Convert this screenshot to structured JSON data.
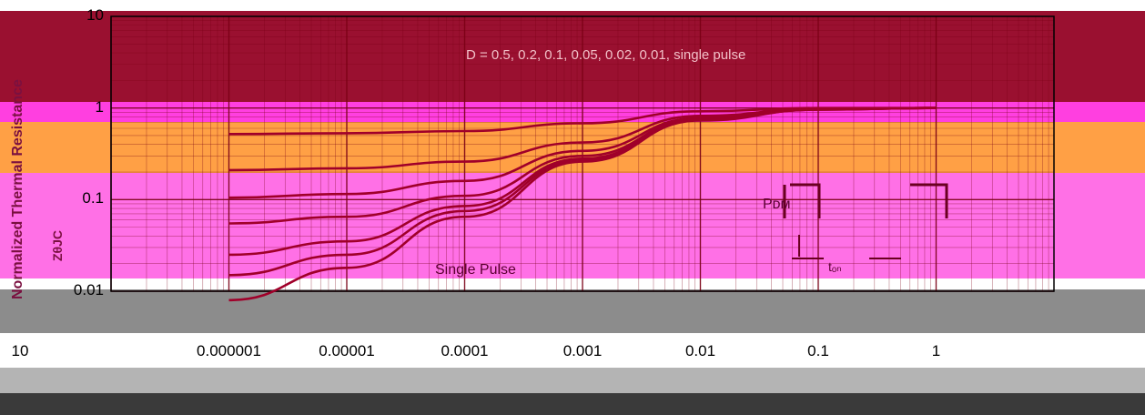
{
  "chart_data": {
    "type": "line",
    "xscale": "log",
    "yscale": "log",
    "xlim": [
      1e-07,
      10
    ],
    "ylim": [
      0.01,
      10
    ],
    "x_tick_labels": [
      "10",
      "0.000001",
      "0.00001",
      "0.0001",
      "0.001",
      "0.01",
      "0.1",
      "1"
    ],
    "y_tick_labels": [
      "10",
      "1",
      "0.1",
      "0.01"
    ],
    "ylabel": "Normalized Thermal Resistance",
    "ylabel_symbol": "ZθJC",
    "annotations": {
      "single_pulse": "Single Pulse",
      "pdm": "Pᴅᴍ",
      "t_on": "tₒₙ",
      "duty_legend": "D = 0.5, 0.2, 0.1, 0.05, 0.02, 0.01, single pulse"
    },
    "series": [
      {
        "name": "0.5",
        "x": [
          1e-06,
          1e-05,
          0.0001,
          0.001,
          0.01,
          0.1,
          1
        ],
        "y": [
          0.52,
          0.53,
          0.56,
          0.68,
          0.92,
          1.0,
          1.0
        ]
      },
      {
        "name": "0.2",
        "x": [
          1e-06,
          1e-05,
          0.0001,
          0.001,
          0.01,
          0.1,
          1
        ],
        "y": [
          0.21,
          0.22,
          0.26,
          0.42,
          0.82,
          0.98,
          1.0
        ]
      },
      {
        "name": "0.1",
        "x": [
          1e-06,
          1e-05,
          0.0001,
          0.001,
          0.01,
          0.1,
          1
        ],
        "y": [
          0.105,
          0.115,
          0.16,
          0.34,
          0.78,
          0.97,
          1.0
        ]
      },
      {
        "name": "0.05",
        "x": [
          1e-06,
          1e-05,
          0.0001,
          0.001,
          0.01,
          0.1,
          1
        ],
        "y": [
          0.055,
          0.065,
          0.11,
          0.3,
          0.76,
          0.97,
          1.0
        ]
      },
      {
        "name": "0.02",
        "x": [
          1e-06,
          1e-05,
          0.0001,
          0.001,
          0.01,
          0.1,
          1
        ],
        "y": [
          0.025,
          0.035,
          0.085,
          0.28,
          0.75,
          0.96,
          1.0
        ]
      },
      {
        "name": "0.01",
        "x": [
          1e-06,
          1e-05,
          0.0001,
          0.001,
          0.01,
          0.1,
          1
        ],
        "y": [
          0.015,
          0.025,
          0.075,
          0.27,
          0.74,
          0.96,
          1.0
        ]
      },
      {
        "name": "single pulse",
        "x": [
          1e-06,
          1e-05,
          0.0001,
          0.001,
          0.01,
          0.1,
          1
        ],
        "y": [
          0.008,
          0.018,
          0.065,
          0.26,
          0.73,
          0.96,
          1.0
        ]
      }
    ],
    "colors": {
      "top_band": "#8b0020",
      "mid_band": "#ff8a3d",
      "pink_band": "#ff66dd",
      "curve": "#a0002a",
      "grid": "#7a0015"
    }
  }
}
